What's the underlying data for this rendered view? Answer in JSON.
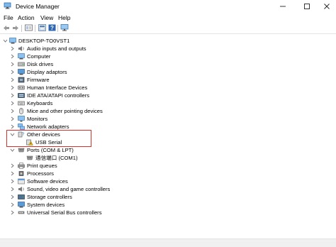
{
  "window": {
    "title": "Device Manager",
    "minimize_icon": "minimize-icon",
    "maximize_icon": "maximize-icon",
    "close_icon": "close-icon"
  },
  "menu": {
    "file": "File",
    "action": "Action",
    "view": "View",
    "help": "Help"
  },
  "toolbar": {
    "buttons": [
      "back-arrow-icon",
      "forward-arrow-icon",
      "properties-icon",
      "update-driver-icon",
      "help-icon",
      "scan-hardware-icon"
    ]
  },
  "tree": {
    "root": "DESKTOP-TO0VST1",
    "items": [
      {
        "label": "Audio inputs and outputs",
        "icon": "speaker-icon"
      },
      {
        "label": "Computer",
        "icon": "computer-icon"
      },
      {
        "label": "Disk drives",
        "icon": "disk-drive-icon"
      },
      {
        "label": "Display adaptors",
        "icon": "display-adapter-icon"
      },
      {
        "label": "Firmware",
        "icon": "firmware-icon"
      },
      {
        "label": "Human Interface Devices",
        "icon": "hid-icon"
      },
      {
        "label": "IDE ATA/ATAPI controllers",
        "icon": "ide-controller-icon"
      },
      {
        "label": "Keyboards",
        "icon": "keyboard-icon"
      },
      {
        "label": "Mice and other pointing devices",
        "icon": "mouse-icon"
      },
      {
        "label": "Monitors",
        "icon": "monitor-icon"
      },
      {
        "label": "Network adapters",
        "icon": "network-adapter-icon"
      },
      {
        "label": "Other devices",
        "icon": "unknown-device-icon",
        "expanded": true
      },
      {
        "label": "USB Serial",
        "icon": "warning-device-icon",
        "child": true
      },
      {
        "label": "Ports (COM & LPT)",
        "icon": "port-icon",
        "expanded": true
      },
      {
        "label": "通信端口 (COM1)",
        "icon": "port-icon",
        "child": true
      },
      {
        "label": "Print queues",
        "icon": "printer-icon"
      },
      {
        "label": "Processors",
        "icon": "processor-icon"
      },
      {
        "label": "Software devices",
        "icon": "software-device-icon"
      },
      {
        "label": "Sound, video and game controllers",
        "icon": "sound-controller-icon"
      },
      {
        "label": "Storage controllers",
        "icon": "storage-controller-icon"
      },
      {
        "label": "System devices",
        "icon": "system-device-icon"
      },
      {
        "label": "Universal Serial Bus controllers",
        "icon": "usb-icon"
      }
    ]
  },
  "colors": {
    "highlight_border": "#d9302c",
    "arrow": "#6d6d6d",
    "window_bg": "#ffffff"
  }
}
